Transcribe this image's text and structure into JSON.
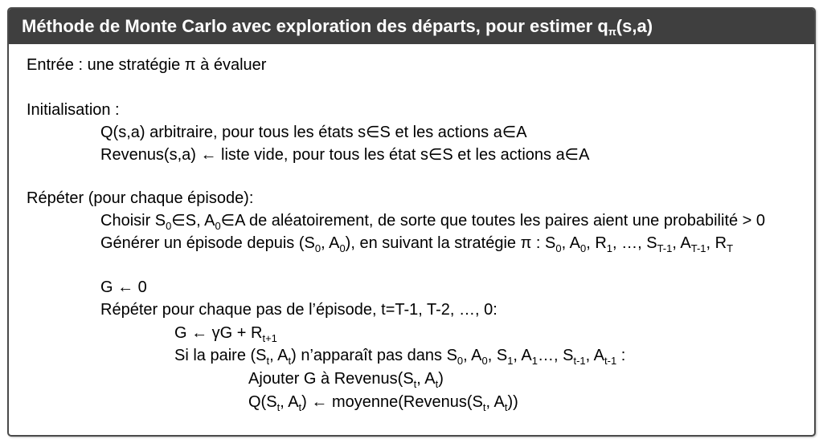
{
  "header": {
    "title": "Méthode de Monte Carlo avec exploration des départs, pour estimer q",
    "title_sub": "π",
    "title_tail": "(s,a)"
  },
  "lines": {
    "input": "Entrée : une stratégie π à évaluer",
    "init_label": "Initialisation :",
    "init_q": "Q(s,a) arbitraire, pour tous les états s∈S et les actions a∈A",
    "init_returns": "Revenus(s,a) ← liste vide, pour tous les état s∈S et les actions a∈A",
    "repeat_label": "Répéter (pour chaque épisode):",
    "choose": {
      "p1": "Choisir S",
      "s1": "0",
      "p2": "∈S, A",
      "s2": "0",
      "p3": "∈A de aléatoirement, de sorte que toutes les paires aient une probabilité > 0"
    },
    "generate": {
      "p1": "Générer un épisode depuis (S",
      "s1": "0",
      "p2": ", A",
      "s2": "0",
      "p3": "), en suivant la stratégie π : S",
      "s3": "0",
      "p4": ", A",
      "s4": "0",
      "p5": ", R",
      "s5": "1",
      "p6": ", …, S",
      "s6": "T-1",
      "p7": ", A",
      "s7": "T-1",
      "p8": ", R",
      "s8": "T"
    },
    "g_init": "G ← 0",
    "repeat_steps": "Répéter pour chaque pas de l’épisode, t=T-1, T-2, …, 0:",
    "g_update": {
      "p1": "G ← γG + R",
      "s1": "t+1"
    },
    "if_pair": {
      "p1": "Si la paire (S",
      "s1": "t",
      "p2": ", A",
      "s2": "t",
      "p3": ") n’apparaît pas dans S",
      "s3": "0",
      "p4": ", A",
      "s4": "0",
      "p5": ", S",
      "s5": "1",
      "p6": ", A",
      "s6": "1",
      "p7": "…, S",
      "s7": "t-1",
      "p8": ", A",
      "s8": "t-1",
      "p9": " :"
    },
    "append": {
      "p1": "Ajouter G à Revenus(S",
      "s1": "t",
      "p2": ", A",
      "s2": "t",
      "p3": ")"
    },
    "q_update": {
      "p1": "Q(S",
      "s1": "t",
      "p2": ", A",
      "s2": "t",
      "p3": ") ← moyenne(Revenus(S",
      "s3": "t",
      "p4": ", A",
      "s4": "t",
      "p5": "))"
    }
  }
}
